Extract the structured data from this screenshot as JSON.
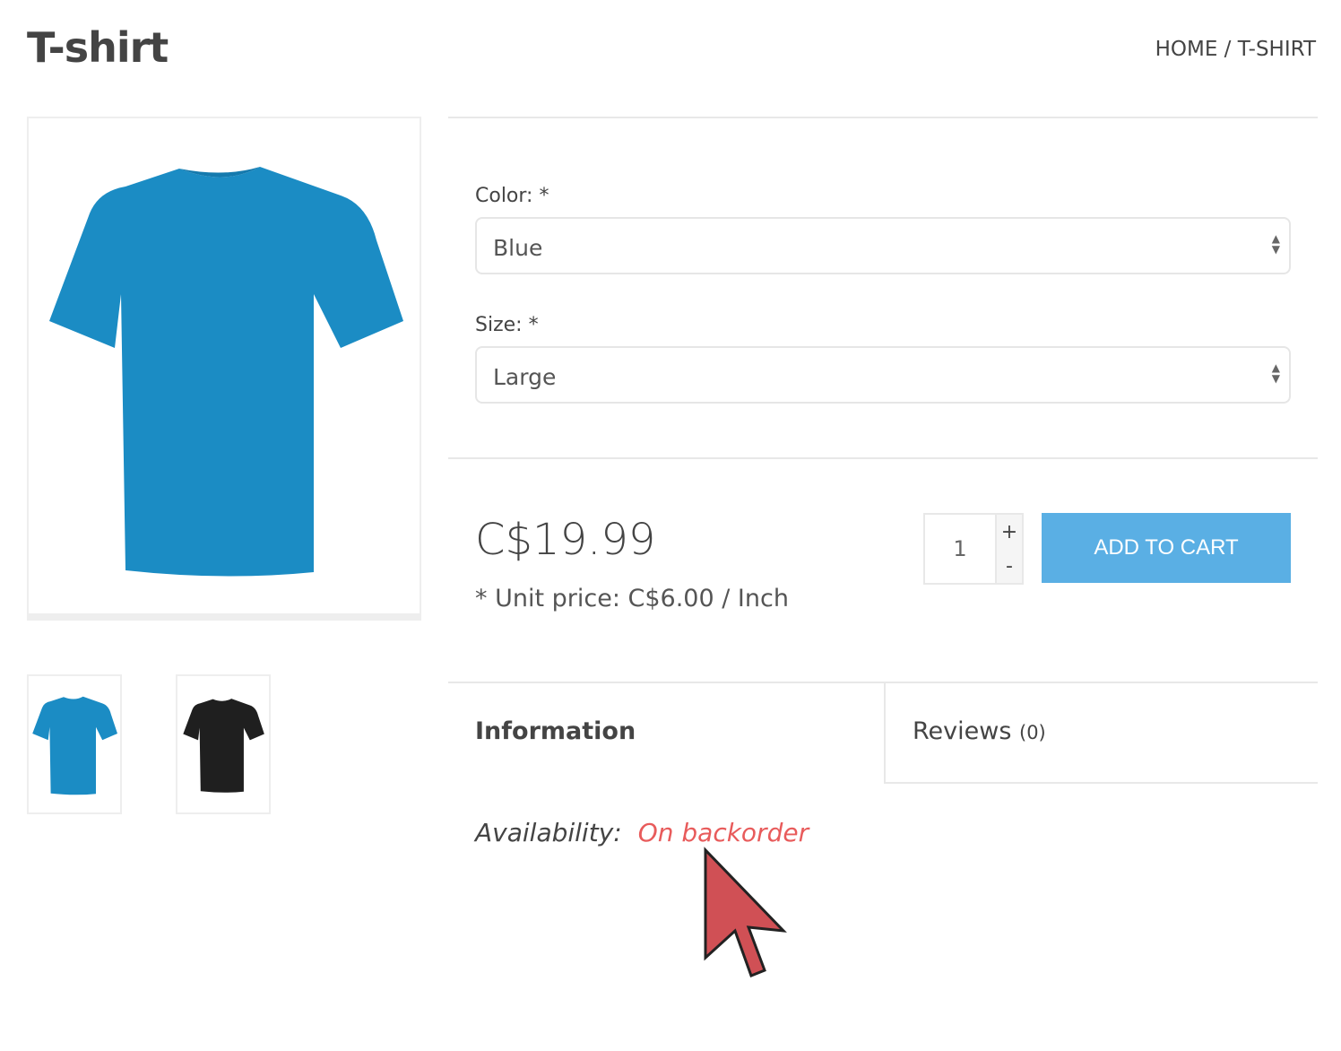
{
  "page": {
    "title": "T-shirt",
    "breadcrumb": "HOME / T-SHIRT"
  },
  "gallery": {
    "thumbnails": [
      {
        "color": "#1b8cc4"
      },
      {
        "color": "#1f1f1f"
      }
    ]
  },
  "options": {
    "color": {
      "label": "Color:  *",
      "value": "Blue"
    },
    "size": {
      "label": "Size:  *",
      "value": "Large"
    }
  },
  "purchase": {
    "price": "C$19.99",
    "unit_price": "* Unit price: C$6.00 / Inch",
    "quantity": "1",
    "plus": "+",
    "minus": "-",
    "add_to_cart": "ADD TO CART",
    "accent": "#5aafe4"
  },
  "tabs": {
    "information": "Information",
    "reviews": "Reviews",
    "reviews_count": "(0)"
  },
  "availability": {
    "label": "Availability:",
    "status": "On backorder",
    "status_color": "#e85b5b"
  }
}
